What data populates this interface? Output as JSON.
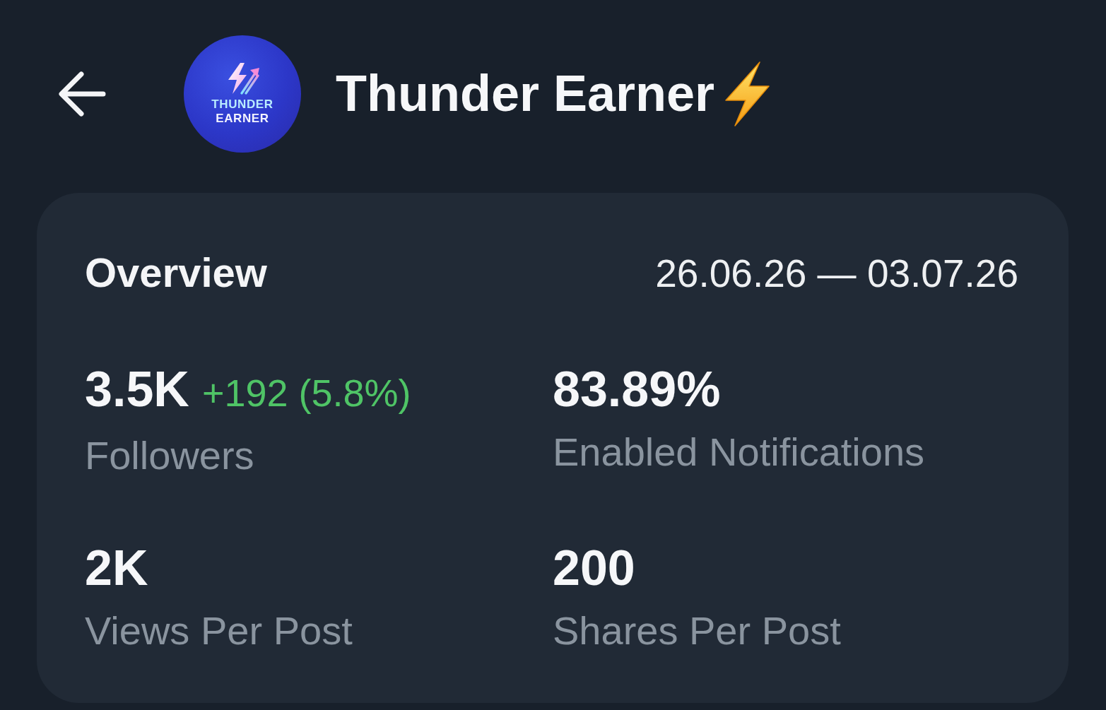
{
  "header": {
    "avatar": {
      "logo_lines": [
        "THUNDER",
        "EARNER"
      ]
    },
    "title": "Thunder Earner"
  },
  "overview": {
    "title": "Overview",
    "date_range": "26.06.26 — 03.07.26",
    "stats": [
      {
        "value": "3.5K",
        "change": {
          "text": "+192 (5.8%)",
          "positive": true
        },
        "label": "Followers"
      },
      {
        "value": "83.89%",
        "label": "Enabled Notifications"
      },
      {
        "value": "2K",
        "label": "Views Per Post"
      },
      {
        "value": "200",
        "label": "Shares Per Post"
      }
    ]
  }
}
